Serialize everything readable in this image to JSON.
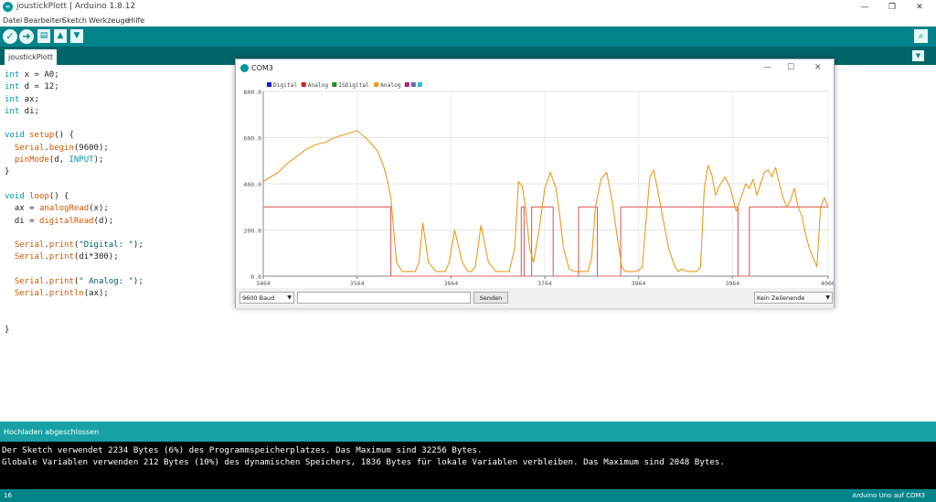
{
  "window": {
    "title": "joustickPlott | Arduino 1.8.12",
    "icon": "arduino-icon",
    "minimize": "—",
    "maximize": "❐",
    "close": "✕"
  },
  "menu": [
    "Datei",
    "Bearbeiten",
    "Sketch",
    "Werkzeuge",
    "Hilfe"
  ],
  "toolbar": {
    "verify": "✓",
    "upload": "➜",
    "new": "▤",
    "open": "▲",
    "save": "▼",
    "serial_monitor": "⌕"
  },
  "tab": {
    "label": "joustickPlott",
    "menu": "▼"
  },
  "code": [
    [
      {
        "t": "int",
        "c": "k"
      },
      {
        "t": " x = A0;"
      }
    ],
    [
      {
        "t": "int",
        "c": "k"
      },
      {
        "t": " d = 12;"
      }
    ],
    [
      {
        "t": "int",
        "c": "k"
      },
      {
        "t": " ax;"
      }
    ],
    [
      {
        "t": "int",
        "c": "k"
      },
      {
        "t": " di;"
      }
    ],
    [],
    [
      {
        "t": "void",
        "c": "k"
      },
      {
        "t": " "
      },
      {
        "t": "setup",
        "c": "f"
      },
      {
        "t": "() {"
      }
    ],
    [
      {
        "t": "  "
      },
      {
        "t": "Serial",
        "c": "f"
      },
      {
        "t": "."
      },
      {
        "t": "begin",
        "c": "f"
      },
      {
        "t": "(9600);"
      }
    ],
    [
      {
        "t": "  "
      },
      {
        "t": "pinMode",
        "c": "f"
      },
      {
        "t": "(d, "
      },
      {
        "t": "INPUT",
        "c": "k"
      },
      {
        "t": ");"
      }
    ],
    [
      {
        "t": "}"
      }
    ],
    [],
    [
      {
        "t": "void",
        "c": "k"
      },
      {
        "t": " "
      },
      {
        "t": "loop",
        "c": "f"
      },
      {
        "t": "() {"
      }
    ],
    [
      {
        "t": "  ax = "
      },
      {
        "t": "analogRead",
        "c": "f"
      },
      {
        "t": "(x);"
      }
    ],
    [
      {
        "t": "  di = "
      },
      {
        "t": "digitalRead",
        "c": "f"
      },
      {
        "t": "(d);"
      }
    ],
    [],
    [
      {
        "t": "  "
      },
      {
        "t": "Serial",
        "c": "f"
      },
      {
        "t": "."
      },
      {
        "t": "print",
        "c": "f"
      },
      {
        "t": "("
      },
      {
        "t": "\"Digital: \"",
        "c": "s"
      },
      {
        "t": ");"
      }
    ],
    [
      {
        "t": "  "
      },
      {
        "t": "Serial",
        "c": "f"
      },
      {
        "t": "."
      },
      {
        "t": "print",
        "c": "f"
      },
      {
        "t": "(di*300);"
      }
    ],
    [],
    [
      {
        "t": "  "
      },
      {
        "t": "Serial",
        "c": "f"
      },
      {
        "t": "."
      },
      {
        "t": "print",
        "c": "f"
      },
      {
        "t": "("
      },
      {
        "t": "\" Analog: \"",
        "c": "s"
      },
      {
        "t": ");"
      }
    ],
    [
      {
        "t": "  "
      },
      {
        "t": "Serial",
        "c": "f"
      },
      {
        "t": "."
      },
      {
        "t": "println",
        "c": "f"
      },
      {
        "t": "(ax);"
      }
    ],
    [],
    [],
    [
      {
        "t": "}"
      }
    ]
  ],
  "status": {
    "text": "Hochladen abgeschlossen"
  },
  "console": [
    "Der Sketch verwendet 2234 Bytes (6%) des Programmspeicherplatzes. Das Maximum sind 32256 Bytes.",
    "Globale Variablen verwenden 212 Bytes (10%) des dynamischen Speichers, 1836 Bytes für lokale Variablen verbleiben. Das Maximum sind 2048 Bytes."
  ],
  "footer": {
    "line": "16",
    "board": "Arduino Uno auf COM3"
  },
  "serial_plotter": {
    "title": "COM3",
    "icon": "arduino-icon",
    "minimize": "—",
    "maximize": "☐",
    "close": "✕",
    "baud": "9600 Baud",
    "send": "Senden",
    "line_ending": "Kein Zeilenende",
    "input_value": ""
  },
  "chart_data": {
    "type": "line",
    "legend_position": "top-left",
    "grid": true,
    "ylim": [
      0,
      800
    ],
    "xlim": [
      3464,
      4066
    ],
    "y_ticks": [
      "800.0",
      "600.0",
      "400.0",
      "200.0",
      "0.0"
    ],
    "x_ticks": [
      "3464",
      "3564",
      "3664",
      "3764",
      "3864",
      "3964",
      "4066"
    ],
    "legend": [
      {
        "name": "Digital",
        "color": "#1a1adb"
      },
      {
        "name": "Analog",
        "color": "#cc2222"
      },
      {
        "name": "ISDigital",
        "color": "#1d8f1d"
      },
      {
        "name": "Analog",
        "color": "#f09a1a"
      },
      {
        "name": "",
        "color": "#b0208f"
      },
      {
        "name": "",
        "color": "#6a6a9a"
      },
      {
        "name": "",
        "color": "#20c0d8"
      }
    ],
    "series": [
      {
        "name": "Digital",
        "color": "#e06060",
        "step": true,
        "x": [
          3464,
          3600,
          3600,
          3739,
          3739,
          3742,
          3742,
          3750,
          3750,
          3773,
          3773,
          3800,
          3800,
          3820,
          3820,
          3845,
          3845,
          3970,
          3970,
          3982,
          3982,
          4066
        ],
        "y": [
          300,
          300,
          0,
          0,
          300,
          300,
          0,
          0,
          300,
          300,
          0,
          0,
          300,
          300,
          0,
          0,
          300,
          300,
          0,
          0,
          300,
          300
        ]
      },
      {
        "name": "Analog",
        "color": "#f09a1a",
        "x": [
          3464,
          3472,
          3480,
          3490,
          3500,
          3510,
          3520,
          3530,
          3540,
          3548,
          3556,
          3564,
          3570,
          3578,
          3586,
          3592,
          3596,
          3600,
          3603,
          3606,
          3612,
          3620,
          3626,
          3630,
          3634,
          3640,
          3648,
          3654,
          3658,
          3662,
          3668,
          3676,
          3682,
          3686,
          3690,
          3696,
          3704,
          3712,
          3718,
          3722,
          3726,
          3732,
          3736,
          3740,
          3744,
          3748,
          3752,
          3758,
          3764,
          3770,
          3776,
          3780,
          3784,
          3790,
          3796,
          3802,
          3806,
          3810,
          3814,
          3818,
          3824,
          3830,
          3836,
          3842,
          3846,
          3850,
          3856,
          3862,
          3868,
          3872,
          3876,
          3880,
          3884,
          3890,
          3896,
          3902,
          3906,
          3910,
          3916,
          3922,
          3926,
          3930,
          3934,
          3938,
          3942,
          3946,
          3950,
          3956,
          3962,
          3968,
          3974,
          3978,
          3982,
          3986,
          3990,
          3994,
          3998,
          4002,
          4006,
          4010,
          4014,
          4018,
          4022,
          4026,
          4030,
          4034,
          4038,
          4042,
          4046,
          4050,
          4054,
          4058,
          4062,
          4066
        ],
        "y": [
          410,
          430,
          450,
          490,
          520,
          550,
          570,
          580,
          600,
          610,
          620,
          630,
          610,
          580,
          540,
          480,
          420,
          340,
          200,
          60,
          20,
          20,
          20,
          60,
          230,
          60,
          20,
          20,
          20,
          60,
          200,
          60,
          20,
          20,
          40,
          220,
          60,
          20,
          20,
          20,
          20,
          120,
          410,
          390,
          280,
          120,
          60,
          200,
          380,
          450,
          380,
          260,
          120,
          30,
          20,
          20,
          20,
          20,
          80,
          300,
          420,
          450,
          320,
          150,
          40,
          20,
          20,
          20,
          40,
          240,
          430,
          460,
          380,
          250,
          120,
          50,
          20,
          30,
          20,
          20,
          20,
          40,
          380,
          480,
          440,
          350,
          390,
          430,
          380,
          280,
          350,
          400,
          380,
          420,
          350,
          400,
          450,
          460,
          430,
          470,
          400,
          340,
          300,
          330,
          380,
          300,
          260,
          180,
          120,
          80,
          40,
          300,
          340,
          300
        ]
      }
    ]
  }
}
